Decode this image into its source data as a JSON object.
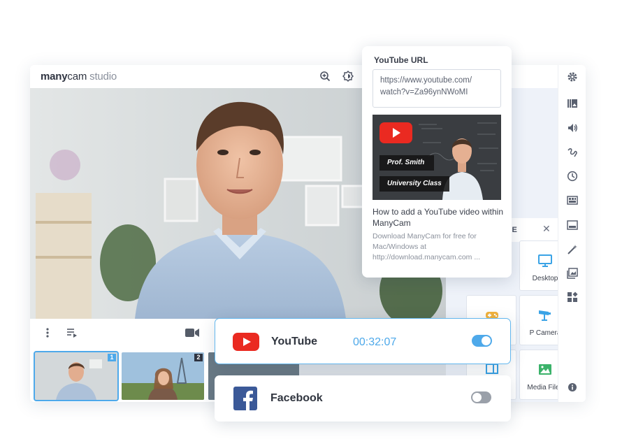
{
  "app": {
    "logo_bold": "many",
    "logo_regular": "cam",
    "logo_suffix": "studio"
  },
  "thumbnails": [
    {
      "number": "1",
      "selected": true
    },
    {
      "number": "2",
      "selected": false
    }
  ],
  "sources_panel": {
    "title": "CE",
    "tiles": [
      {
        "label": "Desktop",
        "icon": "monitor-icon"
      },
      {
        "label": "",
        "icon": "gamepad-icon"
      },
      {
        "label": "P Camera",
        "icon": "ip-camera-icon"
      },
      {
        "label": "",
        "icon": "window-icon"
      },
      {
        "label": "Media Files",
        "icon": "image-icon"
      }
    ]
  },
  "youtube_card": {
    "title": "YouTube URL",
    "url_line1": "https://www.youtube.com/",
    "url_line2": "watch?v=Za96ynNWoMI",
    "lower_third_name": "Prof. Smith",
    "lower_third_title": "University Class",
    "video_title": "How to add a YouTube video within ManyCam",
    "video_description": "Download ManyCam for free for Mac/Windows at http://download.manycam.com ..."
  },
  "streams": [
    {
      "name": "YouTube",
      "time": "00:32:07",
      "enabled": true
    },
    {
      "name": "Facebook",
      "time": "",
      "enabled": false
    }
  ],
  "colors": {
    "accent": "#4ea9ea",
    "youtube_red": "#ea2a21",
    "facebook_blue": "#3b5998",
    "panel_bg": "#eef2f9"
  }
}
